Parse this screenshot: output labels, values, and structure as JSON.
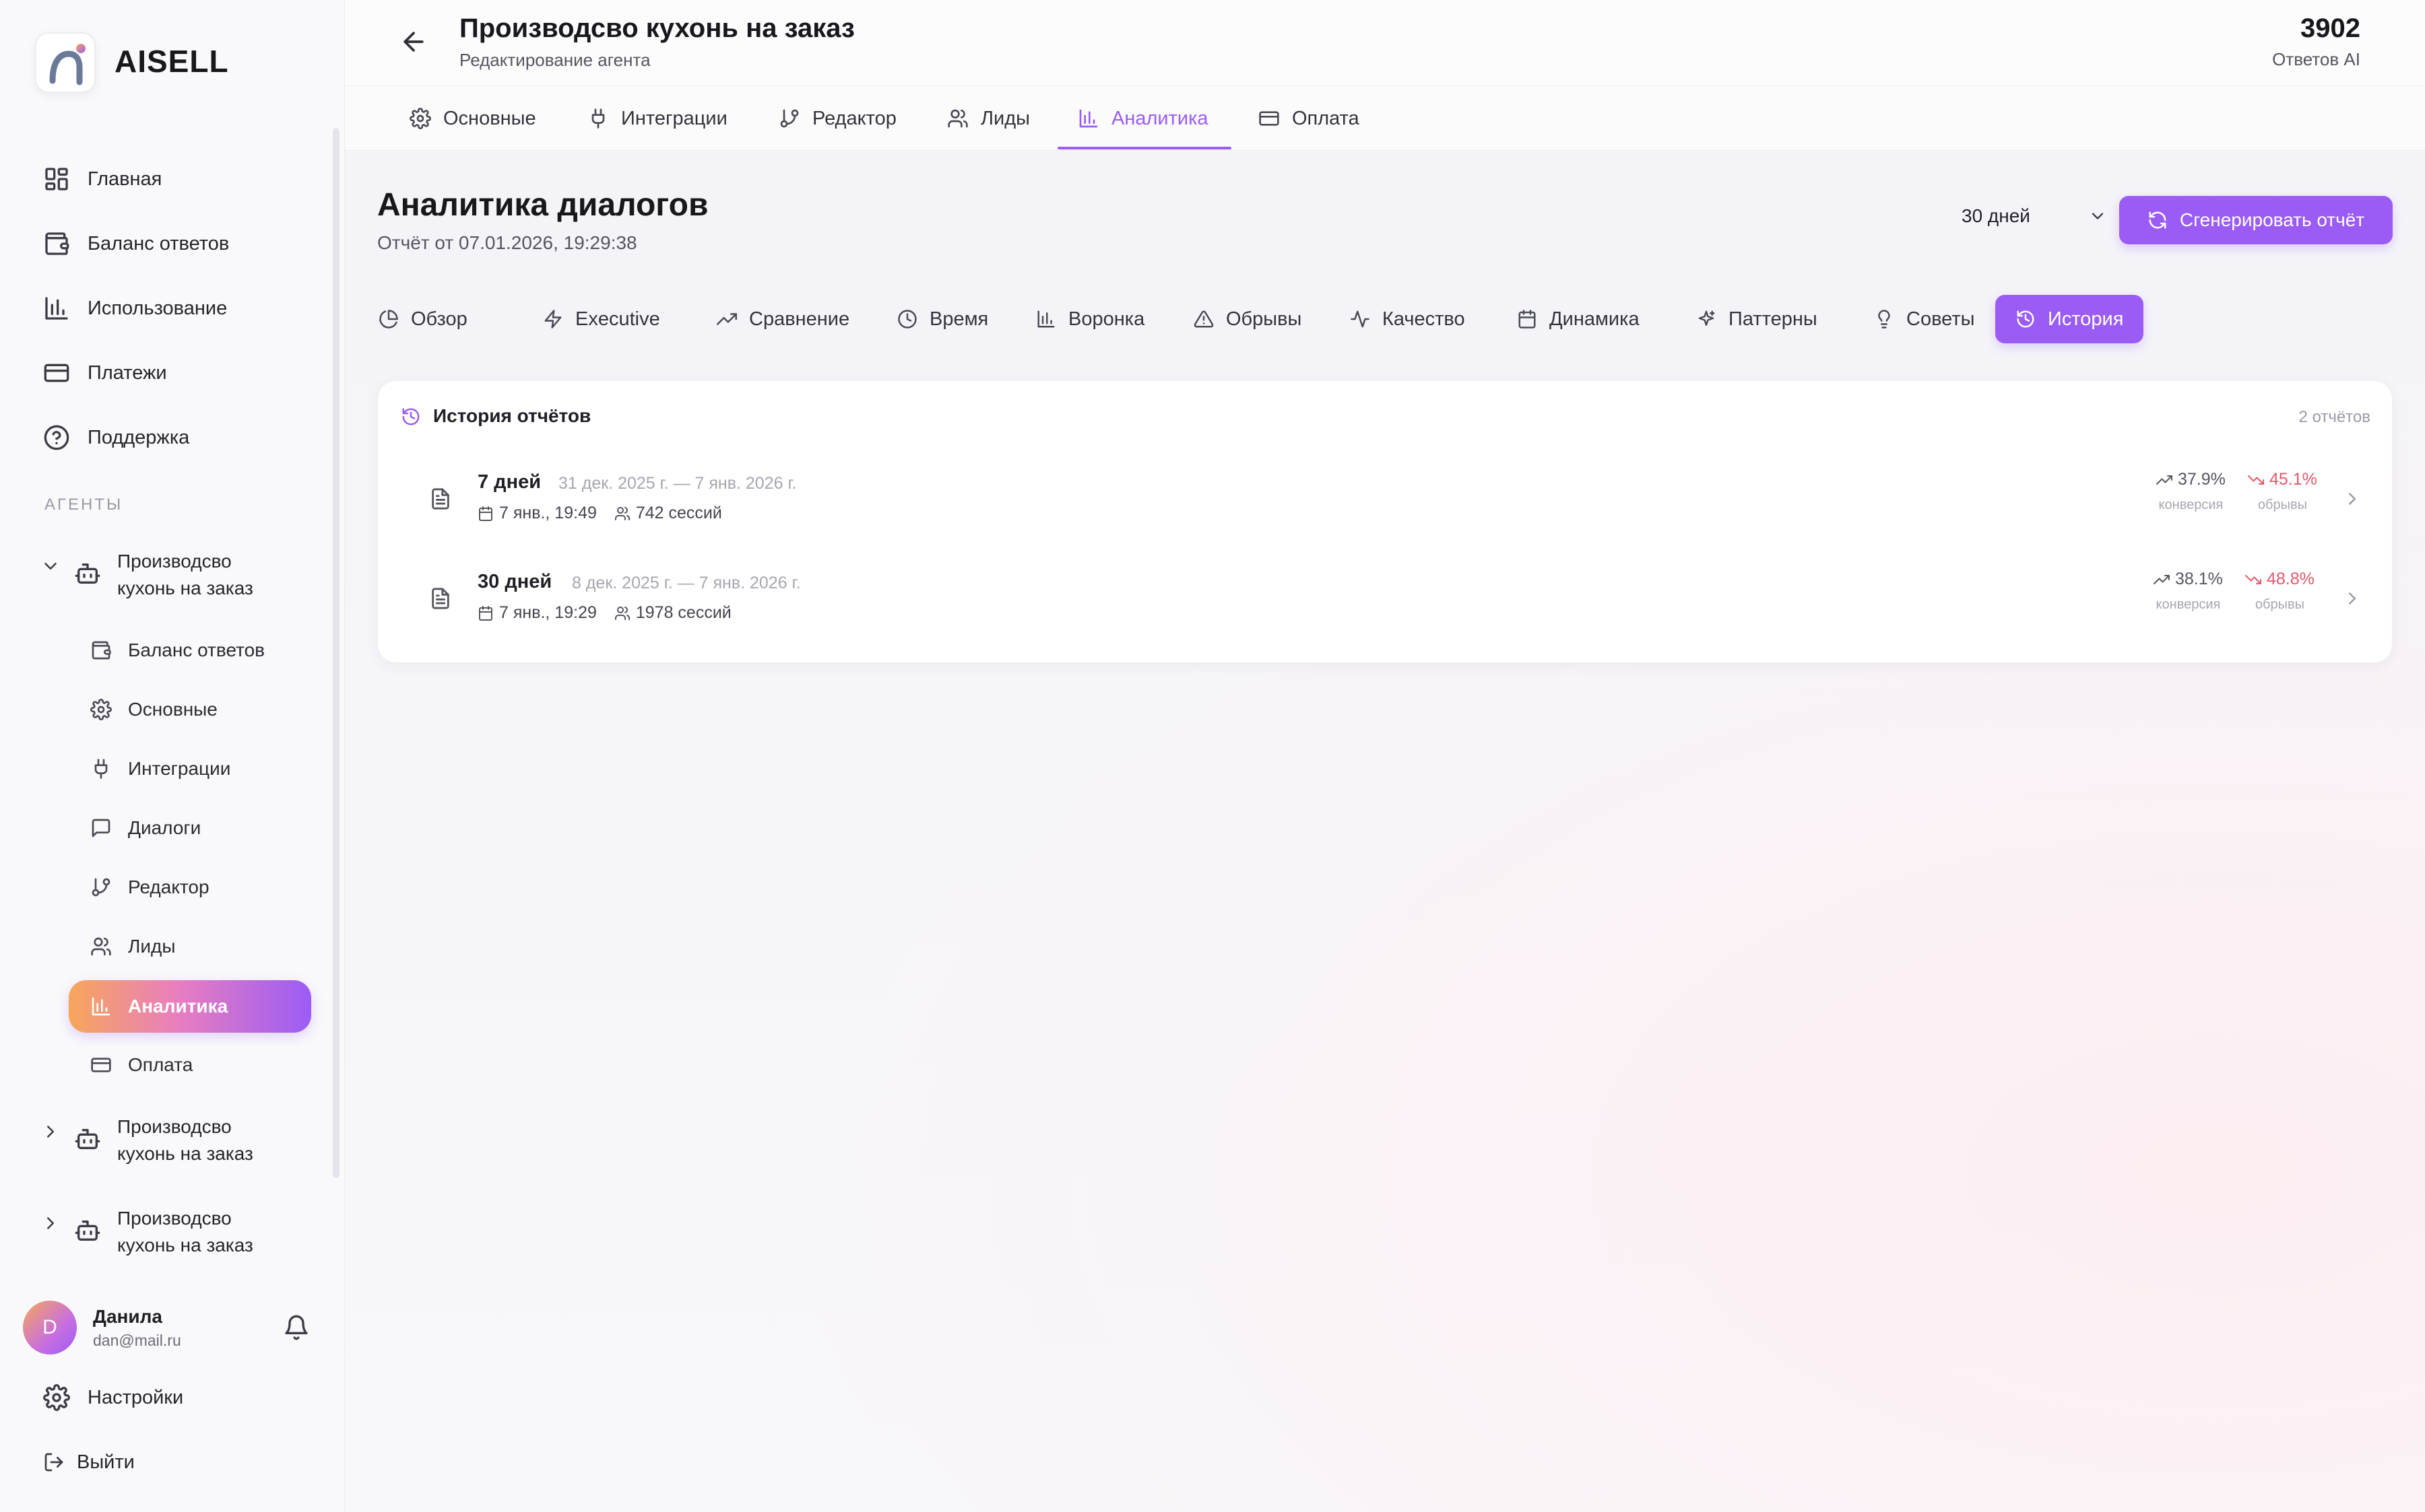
{
  "app": {
    "name": "AISELL"
  },
  "sidebar": {
    "nav": [
      {
        "label": "Главная",
        "icon": "dashboard-icon"
      },
      {
        "label": "Баланс ответов",
        "icon": "wallet-icon"
      },
      {
        "label": "Использование",
        "icon": "bar-chart-icon"
      },
      {
        "label": "Платежи",
        "icon": "credit-card-icon"
      },
      {
        "label": "Поддержка",
        "icon": "help-circle-icon"
      }
    ],
    "section_label": "АГЕНТЫ",
    "agents": [
      {
        "name_line1": "Производсво",
        "name_line2": "кухонь на заказ",
        "expanded": true
      },
      {
        "name_line1": "Производсво",
        "name_line2": "кухонь на заказ",
        "expanded": false
      },
      {
        "name_line1": "Производсво",
        "name_line2": "кухонь на заказ",
        "expanded": false
      }
    ],
    "agent_subitems": [
      {
        "label": "Баланс ответов",
        "icon": "wallet-icon"
      },
      {
        "label": "Основные",
        "icon": "gear-icon"
      },
      {
        "label": "Интеграции",
        "icon": "plug-icon"
      },
      {
        "label": "Диалоги",
        "icon": "chat-icon"
      },
      {
        "label": "Редактор",
        "icon": "git-branch-icon"
      },
      {
        "label": "Лиды",
        "icon": "users-icon"
      },
      {
        "label": "Аналитика",
        "icon": "bar-chart-icon",
        "active": true
      },
      {
        "label": "Оплата",
        "icon": "credit-card-icon"
      }
    ],
    "user": {
      "initial": "D",
      "name": "Данила",
      "email": "dan@mail.ru"
    },
    "settings_label": "Настройки",
    "logout_label": "Выйти"
  },
  "header": {
    "title": "Производсво кухонь на заказ",
    "subtitle": "Редактирование агента",
    "counter_value": "3902",
    "counter_label": "Ответов AI"
  },
  "tabs": [
    {
      "label": "Основные",
      "icon": "gear-icon"
    },
    {
      "label": "Интеграции",
      "icon": "plug-icon"
    },
    {
      "label": "Редактор",
      "icon": "git-branch-icon"
    },
    {
      "label": "Лиды",
      "icon": "users-icon"
    },
    {
      "label": "Аналитика",
      "icon": "bar-chart-icon",
      "active": true
    },
    {
      "label": "Оплата",
      "icon": "credit-card-icon"
    }
  ],
  "analytics": {
    "title": "Аналитика диалогов",
    "report_time": "Отчёт от 07.01.2026, 19:29:38",
    "period_selected": "30 дней",
    "generate_label": "Сгенерировать отчёт",
    "subtabs": [
      {
        "label": "Обзор",
        "icon": "pie-chart-icon"
      },
      {
        "label": "Executive",
        "icon": "zap-icon"
      },
      {
        "label": "Сравнение",
        "icon": "trending-up-icon"
      },
      {
        "label": "Время",
        "icon": "clock-icon"
      },
      {
        "label": "Воронка",
        "icon": "bar-chart-icon"
      },
      {
        "label": "Обрывы",
        "icon": "alert-triangle-icon"
      },
      {
        "label": "Качество",
        "icon": "activity-icon"
      },
      {
        "label": "Динамика",
        "icon": "calendar-icon"
      },
      {
        "label": "Паттерны",
        "icon": "sparkles-icon"
      },
      {
        "label": "Советы",
        "icon": "lightbulb-icon"
      },
      {
        "label": "История",
        "icon": "history-icon",
        "active": true
      }
    ],
    "history": {
      "title": "История отчётов",
      "count": "2 отчётов",
      "reports": [
        {
          "title": "7 дней",
          "range": "31 дек. 2025 г. — 7 янв. 2026 г.",
          "created": "7 янв., 19:49",
          "sessions": "742 сессий",
          "conversion": "37.9%",
          "conversion_label": "конверсия",
          "dropoffs": "45.1%",
          "dropoffs_label": "обрывы"
        },
        {
          "title": "30 дней",
          "range": "8 дек. 2025 г. — 7 янв. 2026 г.",
          "created": "7 янв., 19:29",
          "sessions": "1978 сессий",
          "conversion": "38.1%",
          "conversion_label": "конверсия",
          "dropoffs": "48.8%",
          "dropoffs_label": "обрывы"
        }
      ]
    }
  },
  "colors": {
    "accent": "#9b5cf5",
    "danger": "#e3586a",
    "gradient_start": "#f7a65a"
  }
}
